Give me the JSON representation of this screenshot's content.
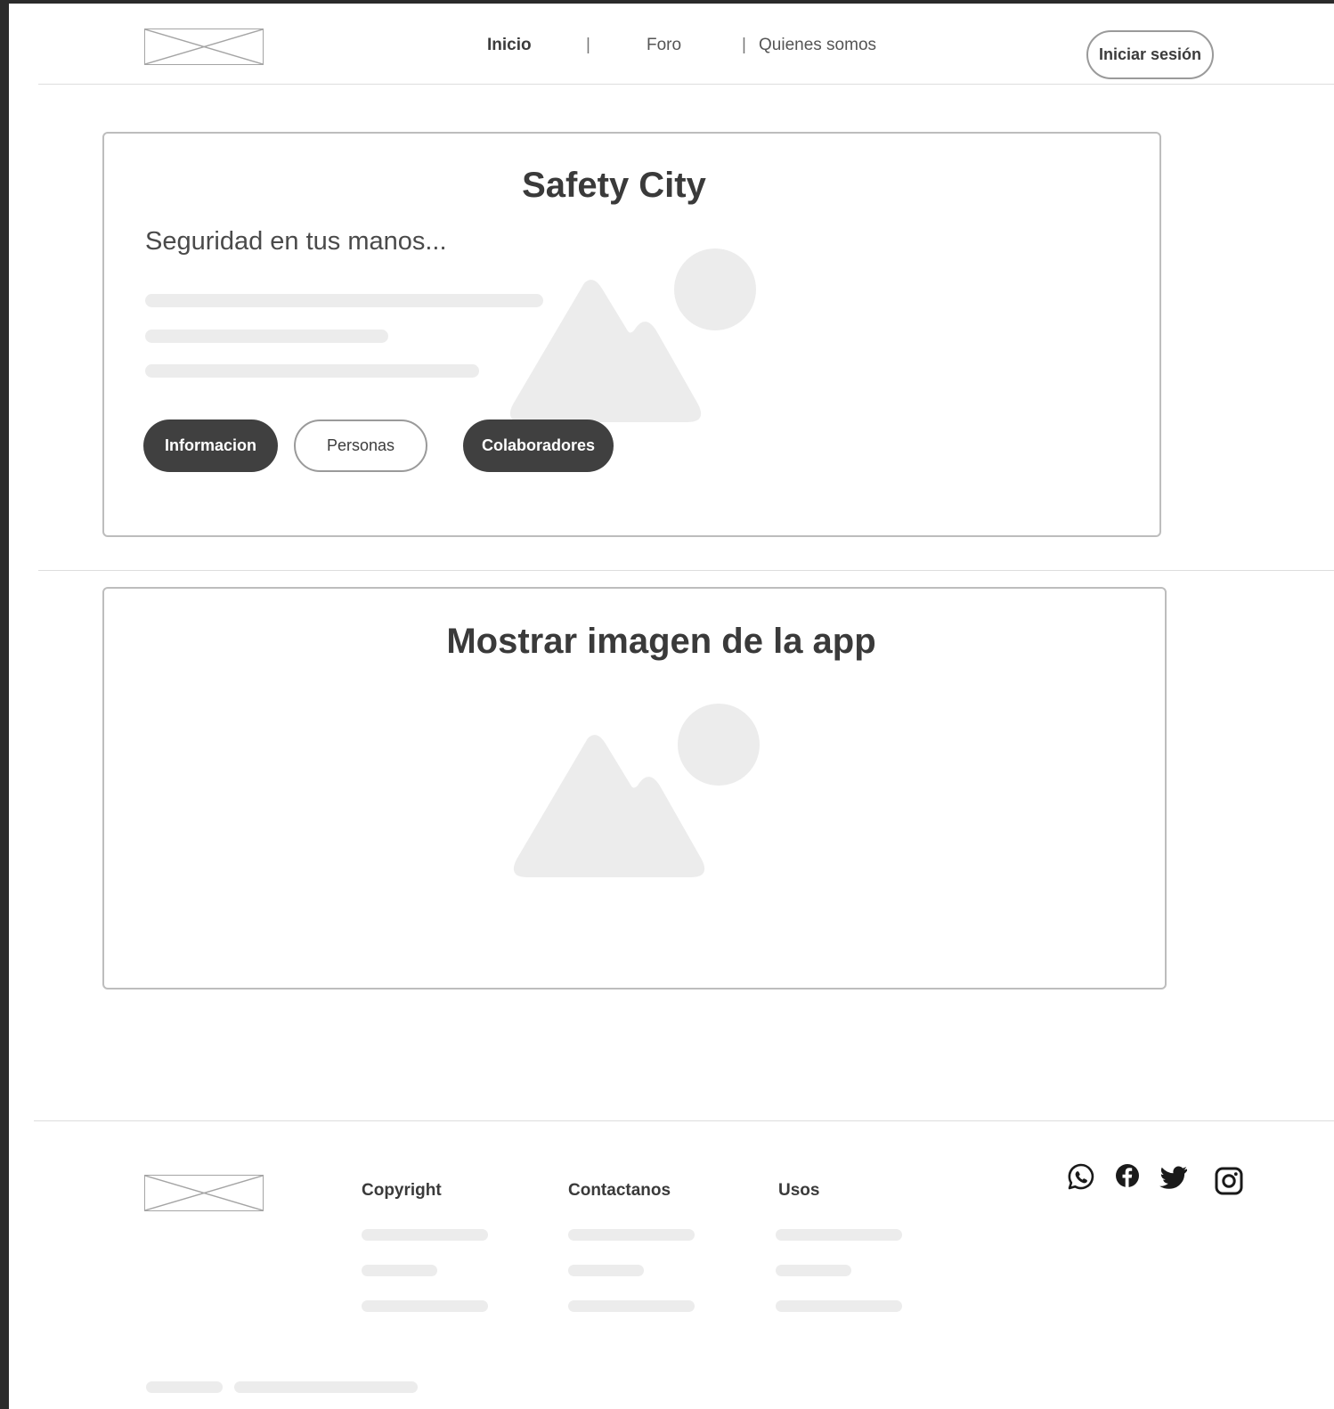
{
  "header": {
    "nav": [
      {
        "label": "Inicio",
        "active": true
      },
      {
        "label": "Foro",
        "active": false
      },
      {
        "label": "Quienes somos",
        "active": false
      }
    ],
    "separator": "|",
    "login_label": "Iniciar sesión"
  },
  "hero": {
    "title": "Safety City",
    "subtitle": "Seguridad en tus manos...",
    "buttons": [
      "Informacion",
      "Personas",
      "Colaboradores"
    ]
  },
  "app_section": {
    "title": "Mostrar imagen de la app"
  },
  "footer": {
    "columns": [
      "Copyright",
      "Contactanos",
      "Usos"
    ],
    "social_icons": [
      "whatsapp-icon",
      "facebook-icon",
      "twitter-icon",
      "instagram-icon"
    ]
  },
  "colors": {
    "dark_button": "#404040",
    "placeholder": "#ececec",
    "border": "#bdbdbd"
  }
}
